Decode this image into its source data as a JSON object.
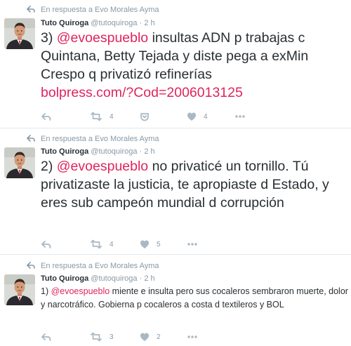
{
  "tweets": [
    {
      "reply_context": "En respuesta a Evo Morales Ayma",
      "name": "Tuto Quiroga",
      "handle": "@tutoquiroga",
      "time": "2 h",
      "text_prefix": "3) ",
      "mention": "@evoespueblo",
      "text_body": " insultas ADN p trabajas c Quintana, Betty Tejada y diste pega a exMin Crespo q privatizó refinerías",
      "link": "bolpress.com/?Cod=2006013125",
      "retweets": "4",
      "likes": "4"
    },
    {
      "reply_context": "En respuesta a Evo Morales Ayma",
      "name": "Tuto Quiroga",
      "handle": "@tutoquiroga",
      "time": "2 h",
      "text_prefix": "2) ",
      "mention": "@evoespueblo",
      "text_body": " no privaticé un tornillo. Tú privatizaste la justicia, te apropiaste d Estado, y eres sub campeón mundial d corrupción",
      "retweets": "4",
      "likes": "5"
    },
    {
      "reply_context": "En respuesta a Evo Morales Ayma",
      "name": "Tuto Quiroga",
      "handle": "@tutoquiroga",
      "time": "2 h",
      "text_prefix": "1) ",
      "mention": "@evoespueblo",
      "text_body": " miente e insulta pero sus cocaleros sembraron muerte, dolor y narcotráfico. Gobierna p cocaleros a costa d textileros y BOL",
      "retweets": "3",
      "likes": "2"
    }
  ],
  "separator": "·",
  "icons": {
    "reply_context": "reply-arrow-icon",
    "reply": "reply-icon",
    "retweet": "retweet-icon",
    "save": "pocket-save-icon",
    "like": "heart-icon",
    "more": "more-dots-icon"
  },
  "colors": {
    "mention": "#e0245e",
    "meta": "#8899a6",
    "text": "#292f33"
  }
}
